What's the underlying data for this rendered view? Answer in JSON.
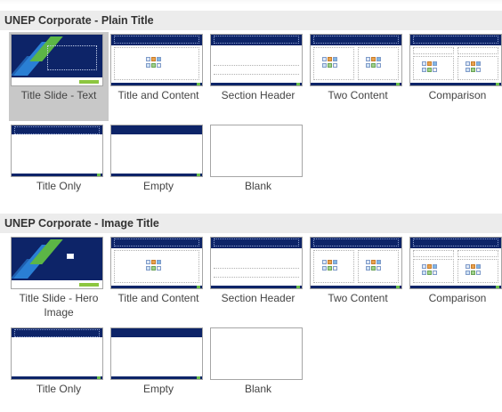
{
  "sections": [
    {
      "header": "UNEP Corporate - Plain Title",
      "layouts": [
        {
          "label": "Title Slide - Text",
          "kind": "title-slide",
          "selected": true
        },
        {
          "label": "Title and Content",
          "kind": "title-content"
        },
        {
          "label": "Section Header",
          "kind": "section-header"
        },
        {
          "label": "Two Content",
          "kind": "two-content"
        },
        {
          "label": "Comparison",
          "kind": "comparison"
        },
        {
          "label": "Title Only",
          "kind": "title-only"
        },
        {
          "label": "Empty",
          "kind": "empty"
        },
        {
          "label": "Blank",
          "kind": "blank"
        }
      ]
    },
    {
      "header": "UNEP Corporate - Image Title",
      "layouts": [
        {
          "label": "Title Slide - Hero Image",
          "kind": "title-slide-hero"
        },
        {
          "label": "Title and Content",
          "kind": "title-content"
        },
        {
          "label": "Section Header",
          "kind": "section-header"
        },
        {
          "label": "Two Content",
          "kind": "two-content"
        },
        {
          "label": "Comparison",
          "kind": "comparison"
        },
        {
          "label": "Title Only",
          "kind": "title-only"
        },
        {
          "label": "Empty",
          "kind": "empty"
        },
        {
          "label": "Blank",
          "kind": "blank"
        }
      ]
    }
  ],
  "colors": {
    "brand_navy": "#0d2468",
    "accent_green": "#5cb646",
    "accent_blue": "#2a7fd4",
    "selection_gray": "#c8c8c8",
    "header_bg": "#ececec"
  }
}
